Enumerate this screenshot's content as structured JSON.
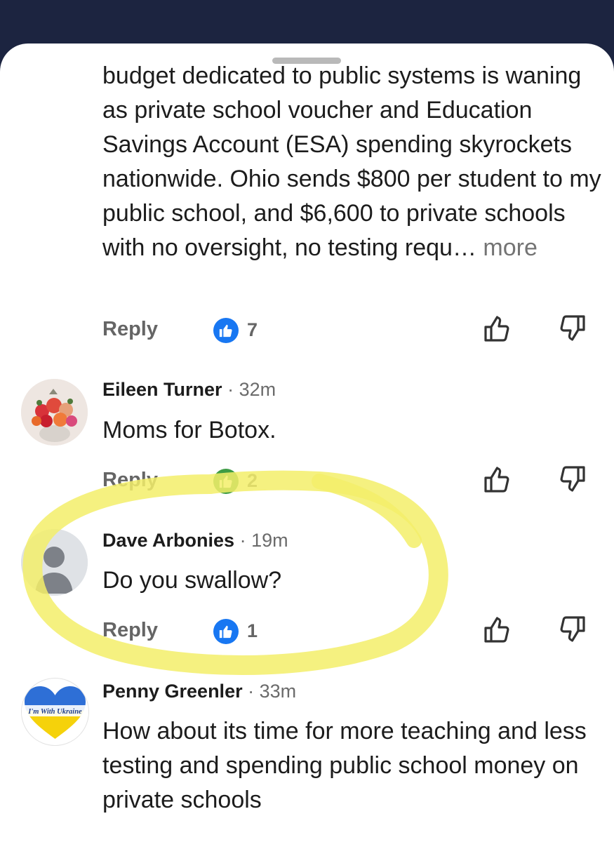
{
  "comments": [
    {
      "text": "budget dedicated to public systems is waning as private school voucher and Education Savings Account (ESA) spending skyrockets nationwide. Ohio sends $800 per student to my public school, and $6,600 to private schools with no oversight, no testing requ…",
      "more_label": "more",
      "reply_label": "Reply",
      "like_count": "7"
    },
    {
      "author": "Eileen Turner",
      "separator": "·",
      "time": "32m",
      "text": "Moms for Botox.",
      "reply_label": "Reply",
      "like_count": "2"
    },
    {
      "author": "Dave Arbonies",
      "separator": "·",
      "time": "19m",
      "text": "Do you swallow?",
      "reply_label": "Reply",
      "like_count": "1"
    },
    {
      "author": "Penny Greenler",
      "separator": "·",
      "time": "33m",
      "avatar_text": "I'm With Ukraine",
      "text": "How about its time for more teaching and less testing and spending public school money on private schools"
    }
  ],
  "colors": {
    "like_badge": "#1877f2",
    "highlight": "#f3ee6a",
    "text": "#1c1c1c",
    "muted": "#656565"
  }
}
